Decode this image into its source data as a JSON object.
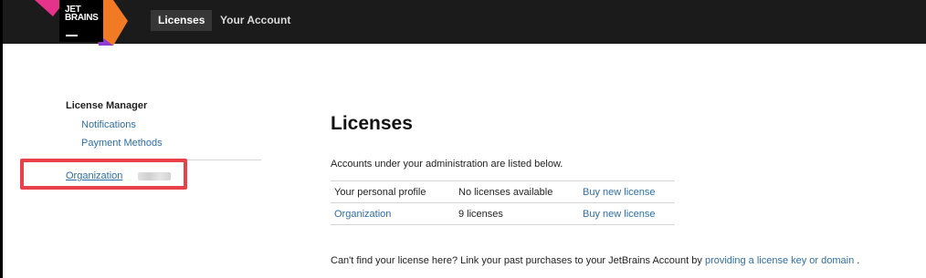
{
  "brand": {
    "line1": "JET",
    "line2": "BRAINS",
    "colors": {
      "pink": "#e5338b",
      "orange": "#f27a24",
      "purple": "#8e3dd6",
      "black": "#000000",
      "topbar": "#1b1b1b"
    }
  },
  "nav": {
    "tabs": [
      {
        "label": "Licenses",
        "active": true
      },
      {
        "label": "Your Account",
        "active": false
      }
    ]
  },
  "sidebar": {
    "heading": "License Manager",
    "items": [
      {
        "label": "Notifications"
      },
      {
        "label": "Payment Methods"
      }
    ],
    "organization_link": "Organization",
    "highlight_color": "#e8414a"
  },
  "main": {
    "title": "Licenses",
    "intro": "Accounts under your administration are listed below.",
    "table": {
      "rows": [
        {
          "account": "Your personal profile",
          "account_is_link": false,
          "status": "No licenses available",
          "action": "Buy new license"
        },
        {
          "account": "Organization",
          "account_is_link": true,
          "status": "9 licenses",
          "action": "Buy new license"
        }
      ]
    },
    "footer": {
      "text": "Can't find your license here? Link your past purchases to your JetBrains Account by",
      "link": "providing a license key or domain",
      "suffix": "."
    }
  },
  "link_color": "#2f6ea3"
}
